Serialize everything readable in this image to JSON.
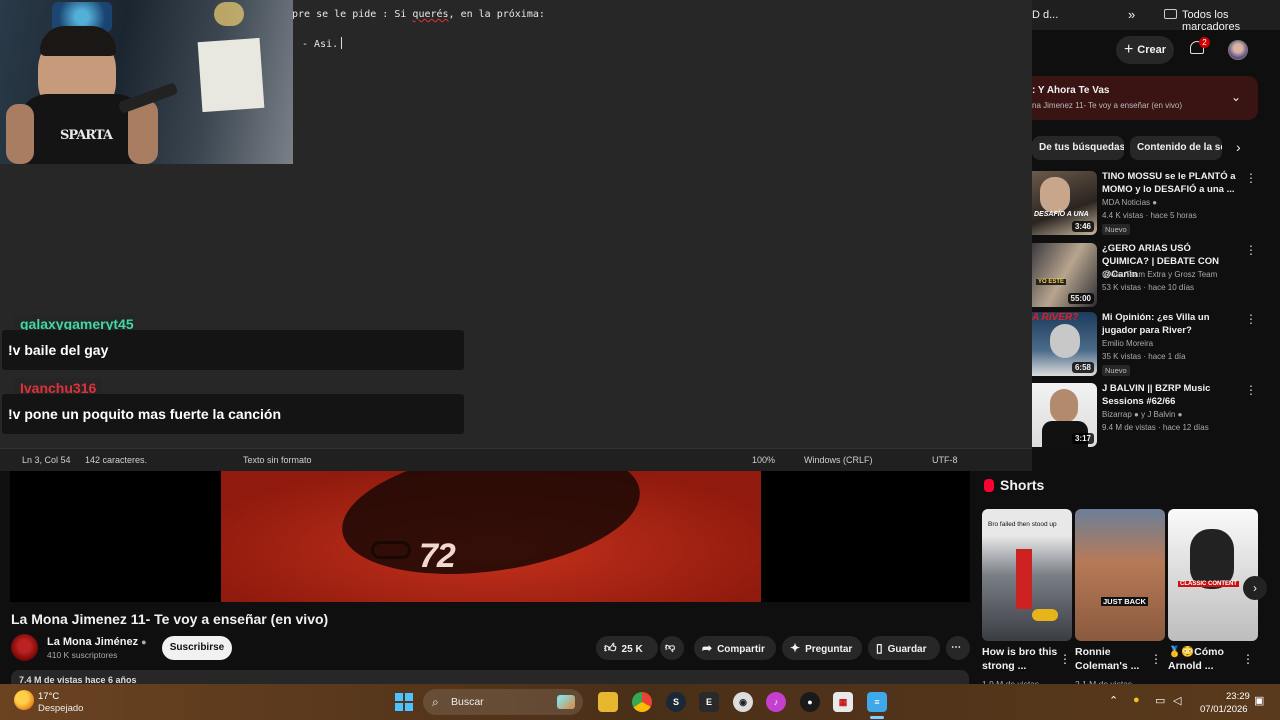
{
  "browser": {
    "bookmark_partial": "D d...",
    "bookmark_overflow": "»",
    "all_bookmarks": "Todos los marcadores"
  },
  "youtube": {
    "create_label": "Crear",
    "notification_count": "2",
    "mix": {
      "title": ": Y Ahora Te Vas",
      "subtitle": "na Jimenez 11- Te voy a enseñar (en vivo)"
    },
    "chips": [
      "De tus búsquedas",
      "Contenido de la ser"
    ],
    "recommendations": [
      {
        "title": "TINO MOSSU se le PLANTÓ a MOMO y lo DESAFIÓ a una ...",
        "channel": "MDA Noticias",
        "verified": true,
        "meta": "4.4 K vistas · hace 5 horas",
        "badge": "Nuevo",
        "duration": "3:46",
        "thumb_text": "DESAFÍO A UNA"
      },
      {
        "title": "¿GERO ARIAS USÓ QUIMICA? | DEBATE CON @Canin",
        "channel": "Grosz Team Extra y Grosz Team",
        "verified": false,
        "meta": "53 K vistas · hace 10 días",
        "badge": "",
        "duration": "55:00",
        "thumb_text": "YO ESTE"
      },
      {
        "title": "Mi Opinión: ¿es Villa un jugador para River?",
        "channel": "Emilio Moreira",
        "verified": false,
        "meta": "35 K vistas · hace 1 día",
        "badge": "Nuevo",
        "duration": "6:58",
        "thumb_text": "A RIVER?"
      },
      {
        "title": "J BALVIN || BZRP Music Sessions #62/66",
        "channel": "Bizarrap",
        "channel_extra": "y J Balvin",
        "verified": true,
        "meta": "9.4 M de vistas · hace 12 días",
        "badge": "",
        "duration": "3:17",
        "thumb_text": ""
      }
    ],
    "shorts": {
      "heading": "Shorts",
      "items": [
        {
          "title": "How is bro this strong ...",
          "meta": "1.9 M de vistas",
          "overlay": "Bro failed then stood up"
        },
        {
          "title": "Ronnie Coleman's ...",
          "meta": "2.1 M de vistas",
          "overlay": "JUST BACK"
        },
        {
          "title": "🥇😳Cómo Arnold ...",
          "meta": "",
          "overlay": "CLASSIC CONTENT"
        }
      ]
    },
    "video": {
      "frame_text": "72",
      "title": "La Mona Jimenez 11- Te voy a enseñar (en vivo)",
      "channel": "La Mona Jiménez",
      "subscribers": "410 K suscriptores",
      "subscribe": "Suscribirse",
      "likes": "25 K",
      "share": "Compartir",
      "ask": "Preguntar",
      "save": "Guardar",
      "desc_partial": "7.4 M de vistas  hace 6 años"
    }
  },
  "notepad": {
    "line1_pre": "pre se le pide : Si ",
    "line1_word": "querés",
    "line1_post": ", en la próxima:",
    "line3": "- Asi.",
    "status": {
      "position": "Ln 3, Col 54",
      "chars": "142 caracteres.",
      "format": "Texto sin formato",
      "zoom": "100%",
      "eol": "Windows (CRLF)",
      "encoding": "UTF-8"
    }
  },
  "webcam": {
    "shirt_text": "SPARTA"
  },
  "chat": [
    {
      "user": "galaxygameryt45",
      "user_color": "#3fd8a8",
      "message": "!v baile del gay"
    },
    {
      "user": "Ivanchu316",
      "user_color": "#e0303a",
      "message": "!v pone un poquito mas fuerte la canción"
    }
  ],
  "taskbar": {
    "temperature": "17°C",
    "weather": "Despejado",
    "search": "Buscar",
    "time": "23:29",
    "date": "07/01/2026"
  }
}
